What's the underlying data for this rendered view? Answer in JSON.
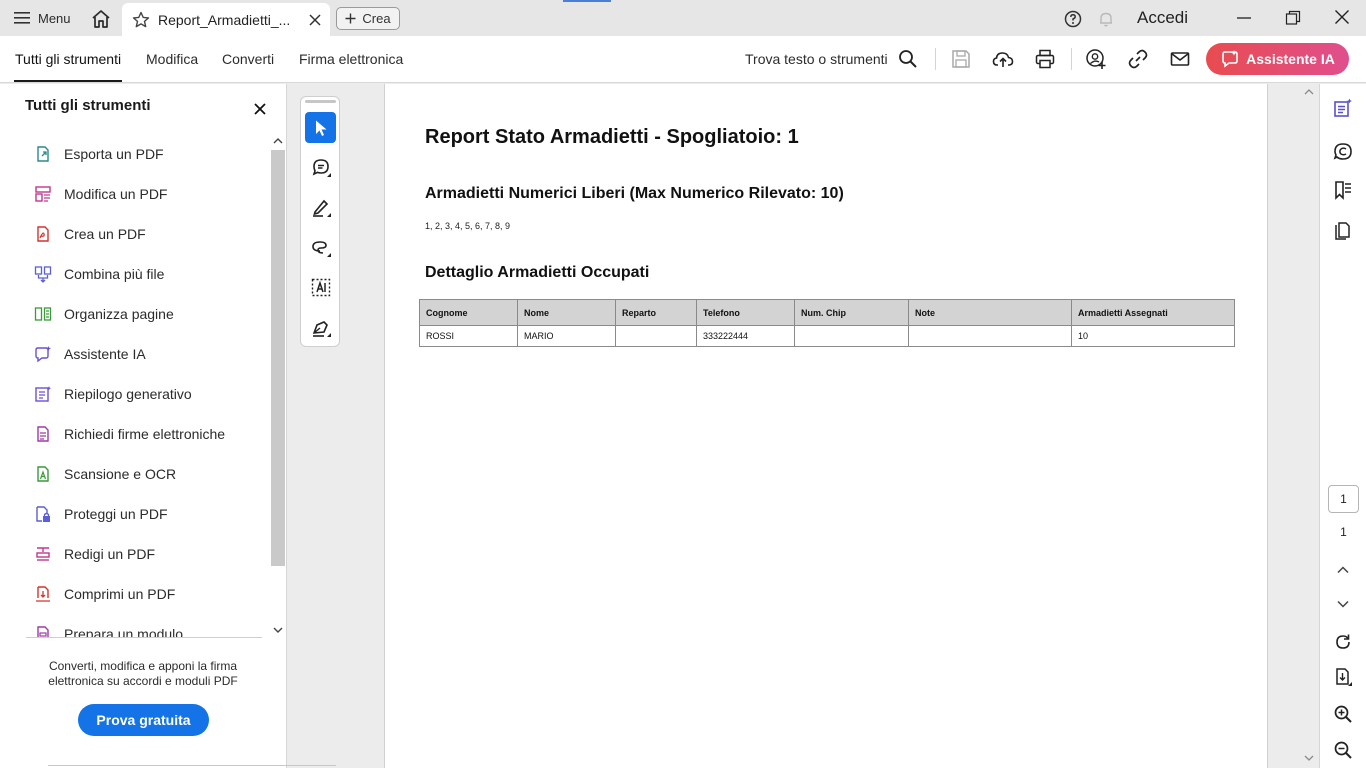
{
  "titlebar": {
    "menu_label": "Menu",
    "tab_title": "Report_Armadietti_...",
    "create_label": "Crea",
    "signin_label": "Accedi"
  },
  "toolbar": {
    "tabs": [
      "Tutti gli strumenti",
      "Modifica",
      "Converti",
      "Firma elettronica"
    ],
    "active_tab": "Tutti gli strumenti",
    "find_label": "Trova testo o strumenti",
    "ai_button": "Assistente IA"
  },
  "left_panel": {
    "title": "Tutti gli strumenti",
    "items": [
      {
        "label": "Esporta un PDF",
        "icon": "export-pdf-icon",
        "color": "#2a8a8a"
      },
      {
        "label": "Modifica un PDF",
        "icon": "edit-pdf-icon",
        "color": "#c2368f"
      },
      {
        "label": "Crea un PDF",
        "icon": "create-pdf-icon",
        "color": "#d6322e"
      },
      {
        "label": "Combina più file",
        "icon": "combine-files-icon",
        "color": "#5a5fd6"
      },
      {
        "label": "Organizza pagine",
        "icon": "organize-pages-icon",
        "color": "#3a9a3a"
      },
      {
        "label": "Assistente IA",
        "icon": "ai-assistant-icon",
        "color": "#6b4fd6"
      },
      {
        "label": "Riepilogo generativo",
        "icon": "generative-summary-icon",
        "color": "#6b4fd6"
      },
      {
        "label": "Richiedi firme elettroniche",
        "icon": "request-signatures-icon",
        "color": "#a03aa8"
      },
      {
        "label": "Scansione e OCR",
        "icon": "scan-ocr-icon",
        "color": "#3a9a3a"
      },
      {
        "label": "Proteggi un PDF",
        "icon": "protect-pdf-icon",
        "color": "#5a5fd6"
      },
      {
        "label": "Redigi un PDF",
        "icon": "redact-pdf-icon",
        "color": "#c2368f"
      },
      {
        "label": "Comprimi un PDF",
        "icon": "compress-pdf-icon",
        "color": "#d6322e"
      },
      {
        "label": "Prepara un modulo",
        "icon": "prepare-form-icon",
        "color": "#a03aa8"
      }
    ],
    "promo_text": "Converti, modifica e apponi la firma elettronica su accordi e moduli PDF",
    "trial_button": "Prova gratuita"
  },
  "document": {
    "title": "Report Stato Armadietti - Spogliatoio: 1",
    "free_heading": "Armadietti Numerici Liberi (Max Numerico Rilevato: 10)",
    "free_list": "1, 2, 3, 4, 5, 6, 7, 8, 9",
    "occupied_heading": "Dettaglio Armadietti Occupati",
    "table": {
      "headers": [
        "Cognome",
        "Nome",
        "Reparto",
        "Telefono",
        "Num. Chip",
        "Note",
        "Armadietti Assegnati"
      ],
      "rows": [
        [
          "ROSSI",
          "MARIO",
          "",
          "333222444",
          "",
          "",
          "10"
        ]
      ]
    }
  },
  "pager": {
    "current_page": "1",
    "total_pages": "1"
  },
  "colors": {
    "accent_blue": "#1473e6",
    "ai_gradient_start": "#e84c50",
    "ai_gradient_end": "#e04f8d"
  }
}
